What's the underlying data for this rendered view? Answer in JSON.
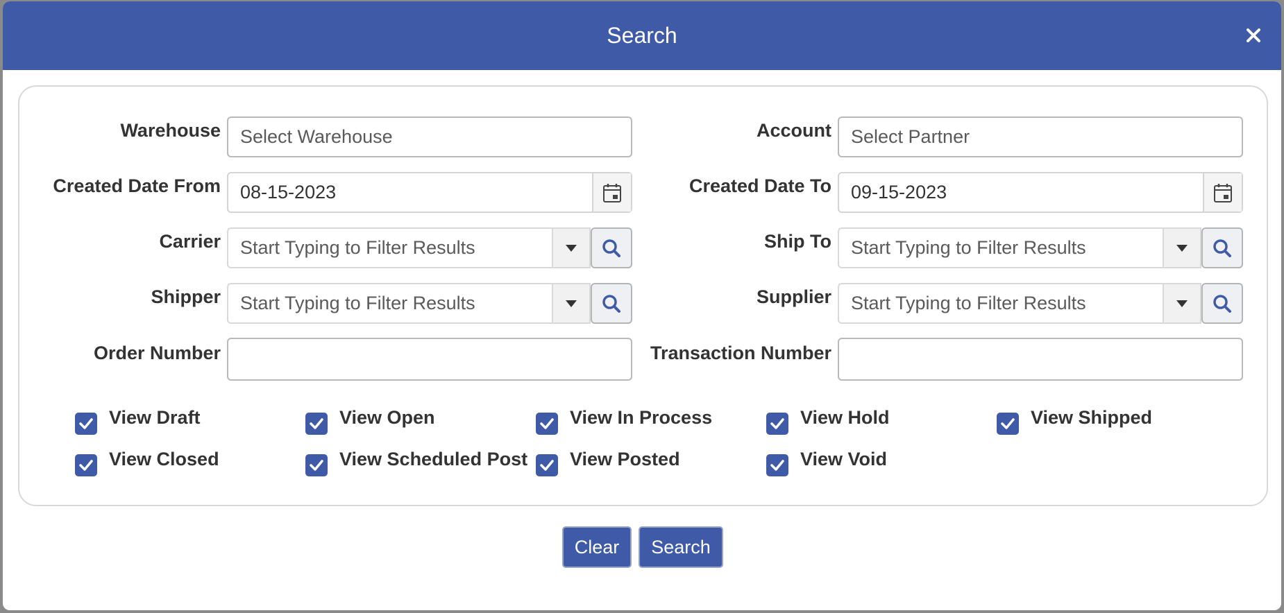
{
  "dialog": {
    "title": "Search",
    "close_icon": "close-icon"
  },
  "form": {
    "warehouse": {
      "label": "Warehouse",
      "placeholder": "Select Warehouse"
    },
    "account": {
      "label": "Account",
      "placeholder": "Select Partner"
    },
    "created_date_from": {
      "label": "Created Date From",
      "value": "08-15-2023",
      "icon": "calendar-icon"
    },
    "created_date_to": {
      "label": "Created Date To",
      "value": "09-15-2023",
      "icon": "calendar-icon"
    },
    "carrier": {
      "label": "Carrier",
      "placeholder": "Start Typing to Filter Results"
    },
    "ship_to": {
      "label": "Ship To",
      "placeholder": "Start Typing to Filter Results"
    },
    "shipper": {
      "label": "Shipper",
      "placeholder": "Start Typing to Filter Results"
    },
    "supplier": {
      "label": "Supplier",
      "placeholder": "Start Typing to Filter Results"
    },
    "order_number": {
      "label": "Order Number",
      "value": ""
    },
    "transaction_number": {
      "label": "Transaction Number",
      "value": ""
    }
  },
  "filters": [
    {
      "label": "View Draft",
      "checked": true
    },
    {
      "label": "View Open",
      "checked": true
    },
    {
      "label": "View In Process",
      "checked": true
    },
    {
      "label": "View Hold",
      "checked": true
    },
    {
      "label": "View Shipped",
      "checked": true
    },
    {
      "label": "View Closed",
      "checked": true
    },
    {
      "label": "View Scheduled Post",
      "checked": true
    },
    {
      "label": "View Posted",
      "checked": true
    },
    {
      "label": "View Void",
      "checked": true
    }
  ],
  "buttons": {
    "clear": "Clear",
    "search": "Search"
  },
  "colors": {
    "accent": "#3f5aa6"
  }
}
